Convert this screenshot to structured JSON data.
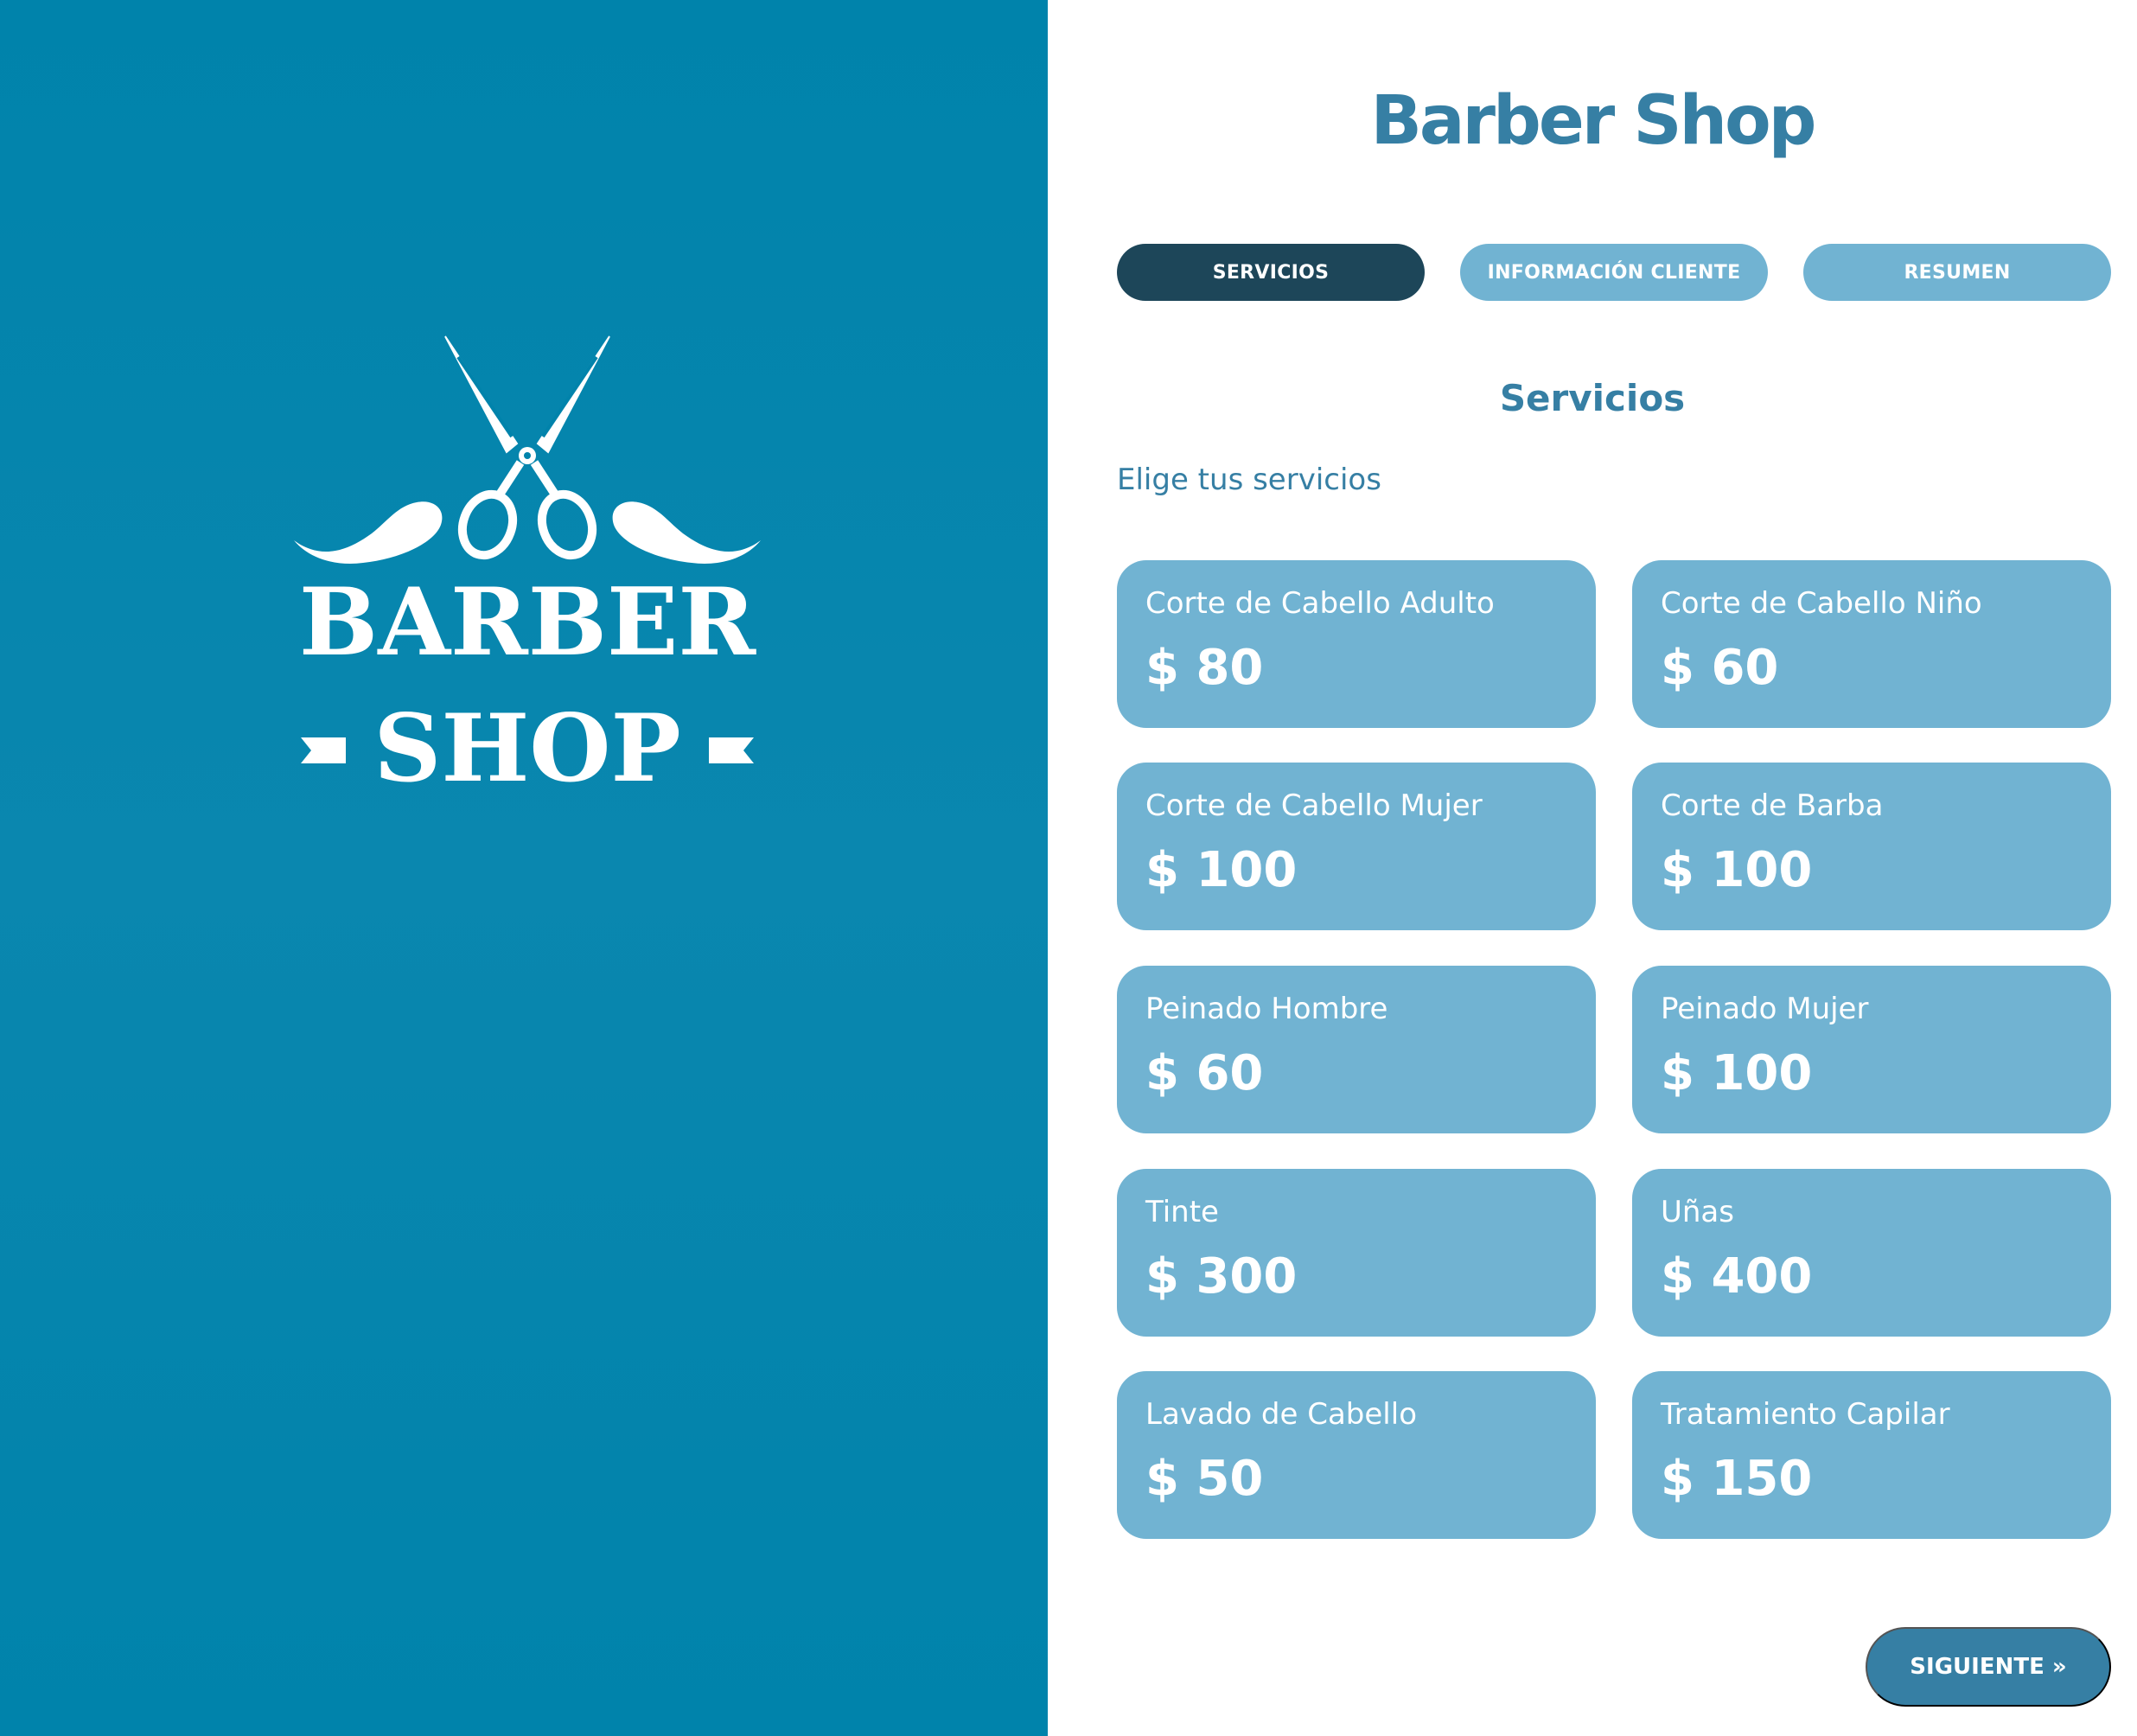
{
  "logo": {
    "line1": "BARBER",
    "line2": "SHOP",
    "icon": "scissors-mustache-icon"
  },
  "header": {
    "title": "Barber Shop"
  },
  "tabs": [
    {
      "label": "SERVICIOS",
      "active": true
    },
    {
      "label": "INFORMACIÓN CLIENTE",
      "active": false
    },
    {
      "label": "RESUMEN",
      "active": false
    }
  ],
  "section": {
    "title": "Servicios",
    "description": "Elige tus servicios"
  },
  "services": [
    {
      "name": "Corte de Cabello Adulto",
      "price": "$ 80"
    },
    {
      "name": "Corte de Cabello Niño",
      "price": "$ 60"
    },
    {
      "name": "Corte de Cabello Mujer",
      "price": "$ 100"
    },
    {
      "name": "Corte de Barba",
      "price": "$ 100"
    },
    {
      "name": "Peinado Hombre",
      "price": "$ 60"
    },
    {
      "name": "Peinado Mujer",
      "price": "$ 100"
    },
    {
      "name": "Tinte",
      "price": "$ 300"
    },
    {
      "name": "Uñas",
      "price": "$ 400"
    },
    {
      "name": "Lavado de Cabello",
      "price": "$ 50"
    },
    {
      "name": "Tratamiento Capilar",
      "price": "$ 150"
    }
  ],
  "footer": {
    "next_label": "SIGUIENTE »"
  },
  "colors": {
    "left_panel": "#0083ab",
    "primary": "#367fa4",
    "tab_active": "#1d4659",
    "card": "#71b3d2",
    "text_light": "#ffffff"
  }
}
